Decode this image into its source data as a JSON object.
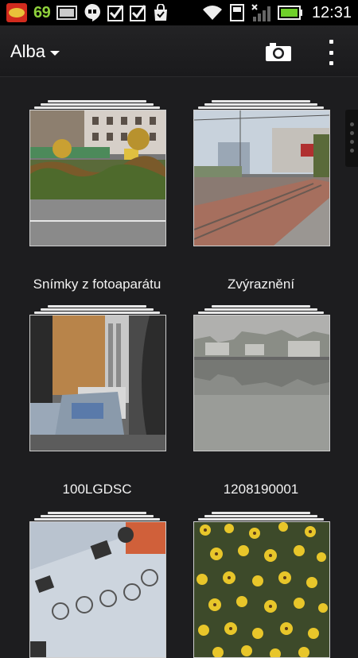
{
  "status_bar": {
    "notification_count": "69",
    "time": "12:31",
    "icons": [
      "app-badge-icon",
      "notification-count",
      "image-icon",
      "hangouts-icon",
      "checkbox-icon",
      "checkbox-icon",
      "shopping-bag-icon",
      "wifi-icon",
      "sd-card-icon",
      "signal-icon",
      "battery-icon"
    ],
    "battery_level": 0.8
  },
  "action_bar": {
    "title": "Alba",
    "camera_icon": "camera-icon",
    "overflow_icon": "more-vert-icon"
  },
  "albums": [
    {
      "label": "Snímky z fotoaparátu"
    },
    {
      "label": "Zvýraznění"
    },
    {
      "label": "100LGDSC"
    },
    {
      "label": "1208190001"
    },
    {
      "label": ""
    },
    {
      "label": ""
    }
  ],
  "colors": {
    "background": "#1d1d1f",
    "status_bar": "#000000",
    "accent_green": "#8fd13c"
  }
}
